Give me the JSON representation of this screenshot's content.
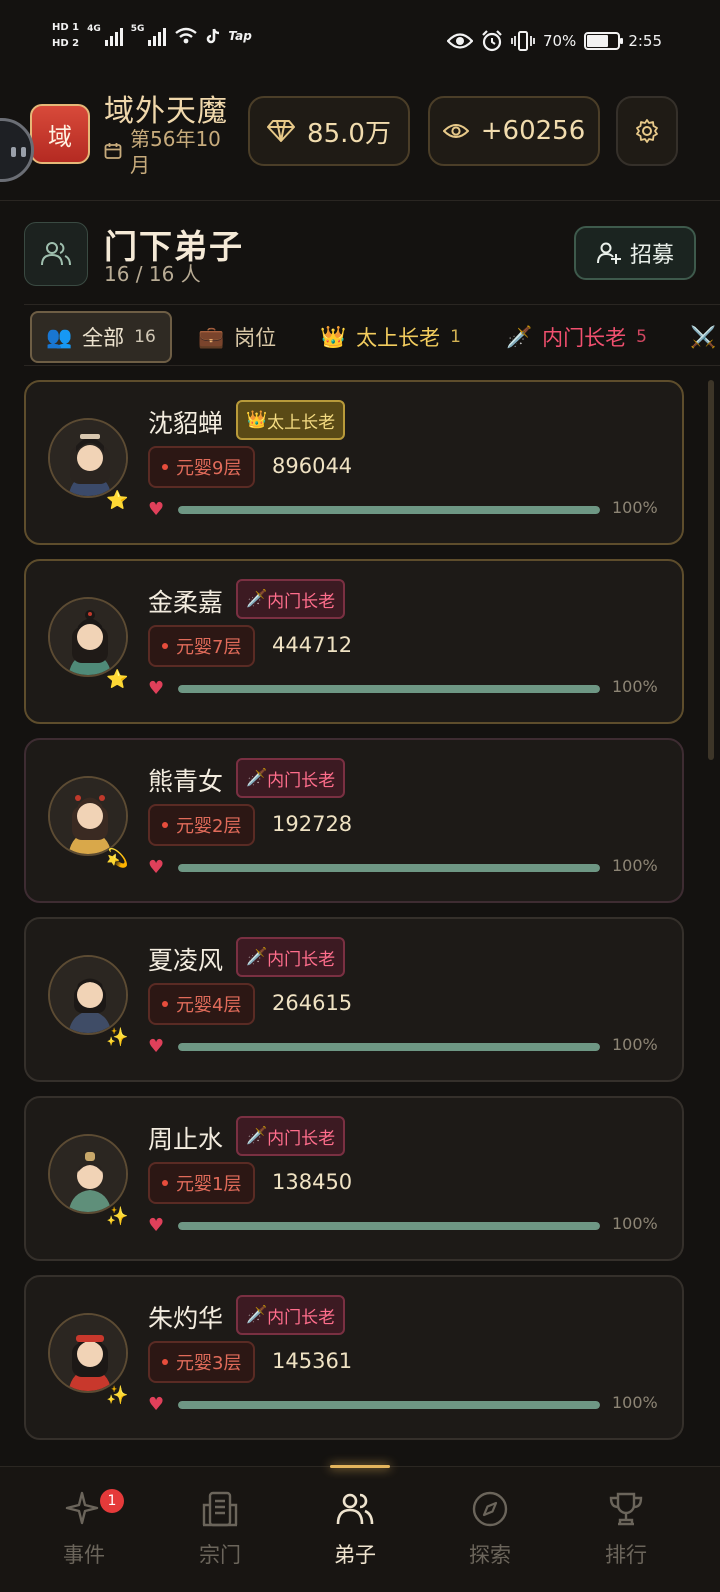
{
  "status_bar": {
    "hd1": "HD 1",
    "hd2": "HD 2",
    "net1": "4G",
    "net2": "5G",
    "tap": "Tap",
    "battery": "70%",
    "battery_level": 0.7,
    "time": "2:55"
  },
  "header": {
    "sect_logo_char": "域",
    "sect_name": "域外天魔",
    "date": "第56年10月",
    "spirit_stones": "85.0万",
    "reputation": "+60256"
  },
  "section": {
    "title": "门下弟子",
    "count": "16 / 16 人",
    "recruit_label": "招募"
  },
  "tabs": [
    {
      "label": "全部",
      "count": "16",
      "icon": "people-emoji",
      "glyph": "👥"
    },
    {
      "label": "岗位",
      "count": "",
      "icon": "briefcase-emoji",
      "glyph": "💼"
    },
    {
      "label": "太上长老",
      "count": "1",
      "icon": "crown-emoji",
      "glyph": "👑"
    },
    {
      "label": "内门长老",
      "count": "5",
      "icon": "dagger-emoji",
      "glyph": "🗡️"
    },
    {
      "label": "",
      "count": "",
      "icon": "crossed-swords-emoji",
      "glyph": "⚔️"
    }
  ],
  "disciples": [
    {
      "name": "沈貂蝉",
      "role": "太上长老",
      "role_icon": "👑",
      "realm": "元婴9层",
      "power": "896044",
      "hp": "100%",
      "hp_level": 1.0,
      "badge": "⭐"
    },
    {
      "name": "金柔嘉",
      "role": "内门长老",
      "role_icon": "🗡️",
      "realm": "元婴7层",
      "power": "444712",
      "hp": "100%",
      "hp_level": 1.0,
      "badge": "⭐"
    },
    {
      "name": "熊青女",
      "role": "内门长老",
      "role_icon": "🗡️",
      "realm": "元婴2层",
      "power": "192728",
      "hp": "100%",
      "hp_level": 1.0,
      "badge": "💫"
    },
    {
      "name": "夏凌风",
      "role": "内门长老",
      "role_icon": "🗡️",
      "realm": "元婴4层",
      "power": "264615",
      "hp": "100%",
      "hp_level": 1.0,
      "badge": "✨"
    },
    {
      "name": "周止水",
      "role": "内门长老",
      "role_icon": "🗡️",
      "realm": "元婴1层",
      "power": "138450",
      "hp": "100%",
      "hp_level": 1.0,
      "badge": "✨"
    },
    {
      "name": "朱灼华",
      "role": "内门长老",
      "role_icon": "🗡️",
      "realm": "元婴3层",
      "power": "145361",
      "hp": "100%",
      "hp_level": 1.0,
      "badge": "✨"
    }
  ],
  "bottom_nav": [
    {
      "label": "事件",
      "icon": "sparkle-icon",
      "badge": "1"
    },
    {
      "label": "宗门",
      "icon": "building-icon",
      "badge": ""
    },
    {
      "label": "弟子",
      "icon": "people-icon",
      "badge": ""
    },
    {
      "label": "探索",
      "icon": "compass-icon",
      "badge": ""
    },
    {
      "label": "排行",
      "icon": "trophy-icon",
      "badge": ""
    }
  ],
  "colors": {
    "background": "#141210",
    "gold_accent": "#e3b45d",
    "elder_role": "#f5dc82",
    "inner_role": "#ff6e8c",
    "realm_red": "#e06b5a",
    "hp_bar": "#6e9784"
  }
}
